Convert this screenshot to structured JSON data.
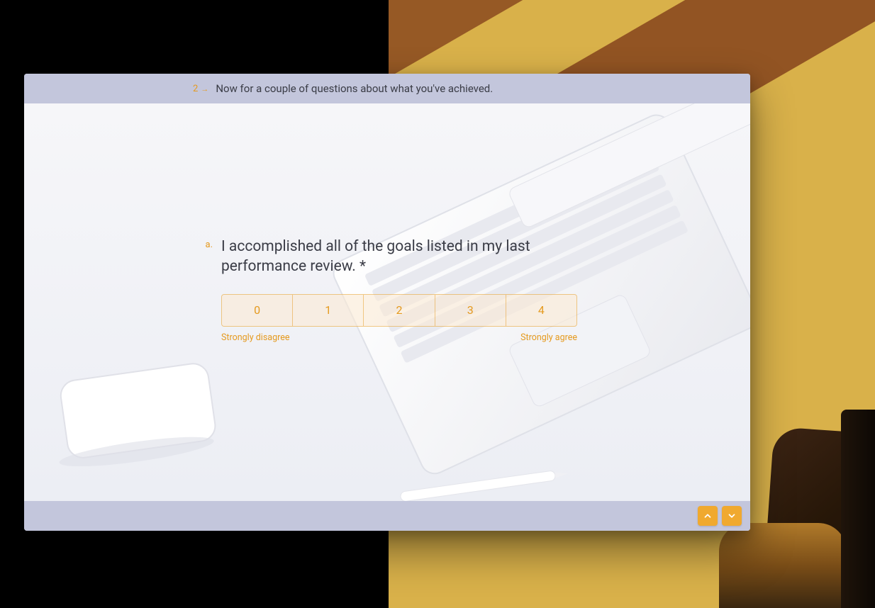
{
  "header": {
    "question_number": "2",
    "arrow": "→",
    "title": "Now for a couple of questions about what you've achieved."
  },
  "question": {
    "letter": "a.",
    "prompt": "I accomplished all of the goals listed in my last performance review. *"
  },
  "likert": {
    "options": [
      "0",
      "1",
      "2",
      "3",
      "4"
    ],
    "min_label": "Strongly disagree",
    "max_label": "Strongly agree"
  },
  "colors": {
    "accent": "#e59a1f",
    "header_bg": "#c3c6dc",
    "app_bg": "#f1f2f6"
  },
  "nav": {
    "prev": "prev",
    "next": "next"
  }
}
